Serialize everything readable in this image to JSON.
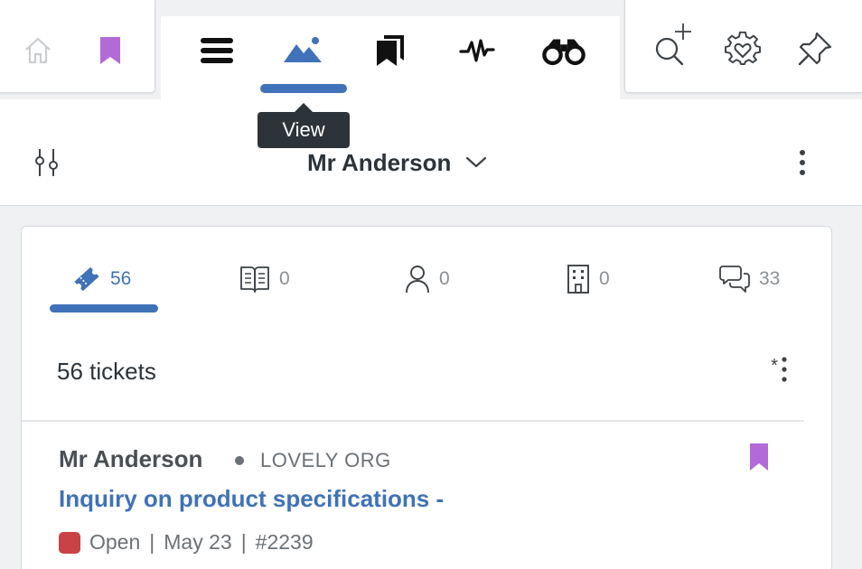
{
  "toolbar": {
    "tooltip": "View",
    "colors": {
      "active": "#3f72b8",
      "bookmark": "#b36ad9"
    }
  },
  "header": {
    "person_name": "Mr Anderson"
  },
  "tabs": [
    {
      "icon": "ticket-icon",
      "count": "56",
      "active": true
    },
    {
      "icon": "book-icon",
      "count": "0"
    },
    {
      "icon": "person-icon",
      "count": "0"
    },
    {
      "icon": "building-icon",
      "count": "0"
    },
    {
      "icon": "chat-bubbles-icon",
      "count": "33"
    }
  ],
  "list": {
    "tickets_count": "56 tickets",
    "options_star": "*"
  },
  "ticket": {
    "person": "Mr Anderson",
    "org": "LOVELY ORG",
    "subject": "Inquiry on product specifications -",
    "status": "Open",
    "status_color": "#c94244",
    "date": "May 23",
    "number": "#2239",
    "separator": "|"
  }
}
